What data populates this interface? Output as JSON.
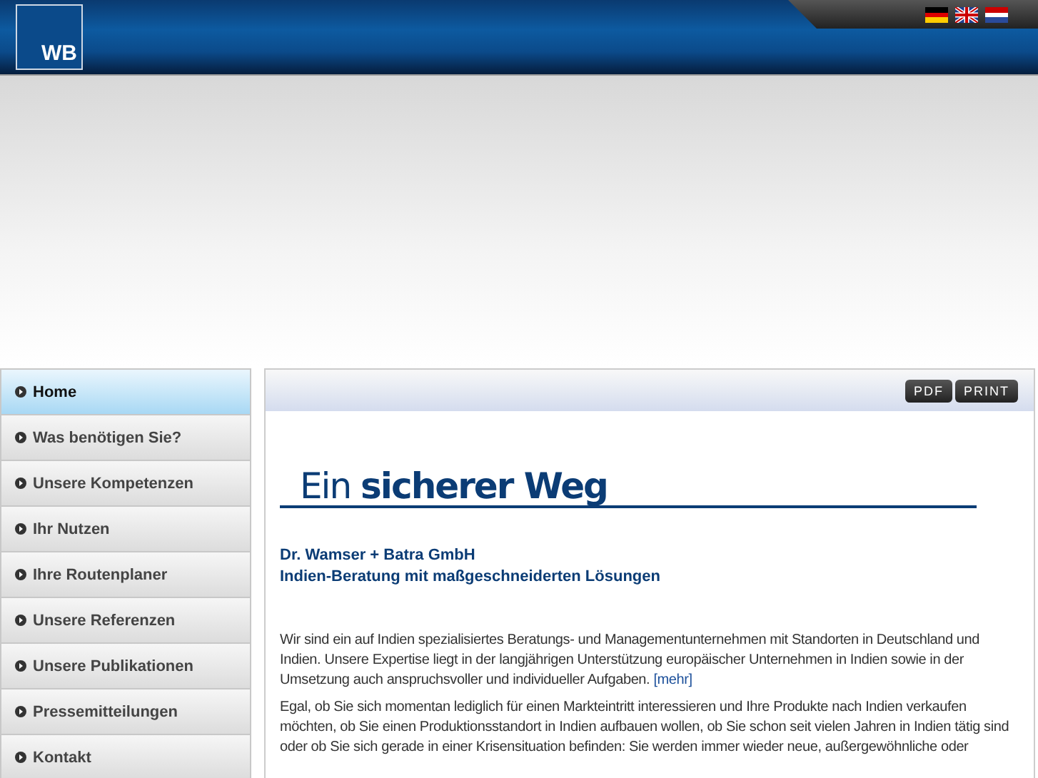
{
  "header": {
    "logo": "WB"
  },
  "nav": [
    {
      "label": "Home",
      "selected": true
    },
    {
      "label": "Was benötigen Sie?",
      "selected": false
    },
    {
      "label": "Unsere Kompetenzen",
      "selected": false
    },
    {
      "label": "Ihr Nutzen",
      "selected": false
    },
    {
      "label": "Ihre Routenplaner",
      "selected": false
    },
    {
      "label": "Unsere Referenzen",
      "selected": false
    },
    {
      "label": "Unsere Publikationen",
      "selected": false
    },
    {
      "label": "Pressemitteilungen",
      "selected": false
    },
    {
      "label": "Kontakt",
      "selected": false
    }
  ],
  "toolbar": {
    "buttons": [
      "PDF",
      "PRINT"
    ]
  },
  "content": {
    "heading": "Ein **sicherer Weg**",
    "company": "Dr. Wamser + Batra GmbH",
    "tagline": "Indien-Beratung mit maßgeschneiderten Lösungen",
    "paragraphs": [
      {
        "text": "Wir sind ein auf Indien spezialisiertes Beratungs- und Managementunternehmen mit Standorten in Deutschland und Indien. Unsere Expertise liegt in der langjährigen Unterstützung europäischer Unternehmen in Indien sowie in der Umsetzung auch anspruchsvoller und individueller Aufgaben.",
        "link": "[mehr]"
      },
      {
        "text": "Egal, ob Sie sich momentan lediglich für einen Markteintritt interessieren und Ihre Produkte nach Indien verkaufen möchten, ob Sie einen Produktionsstandort in Indien aufbauen wollen, ob Sie schon seit vielen Jahren in Indien tätig sind oder ob Sie sich gerade in einer Krisensituation befinden: Sie werden immer wieder neue, außergewöhnliche oder"
      }
    ]
  }
}
